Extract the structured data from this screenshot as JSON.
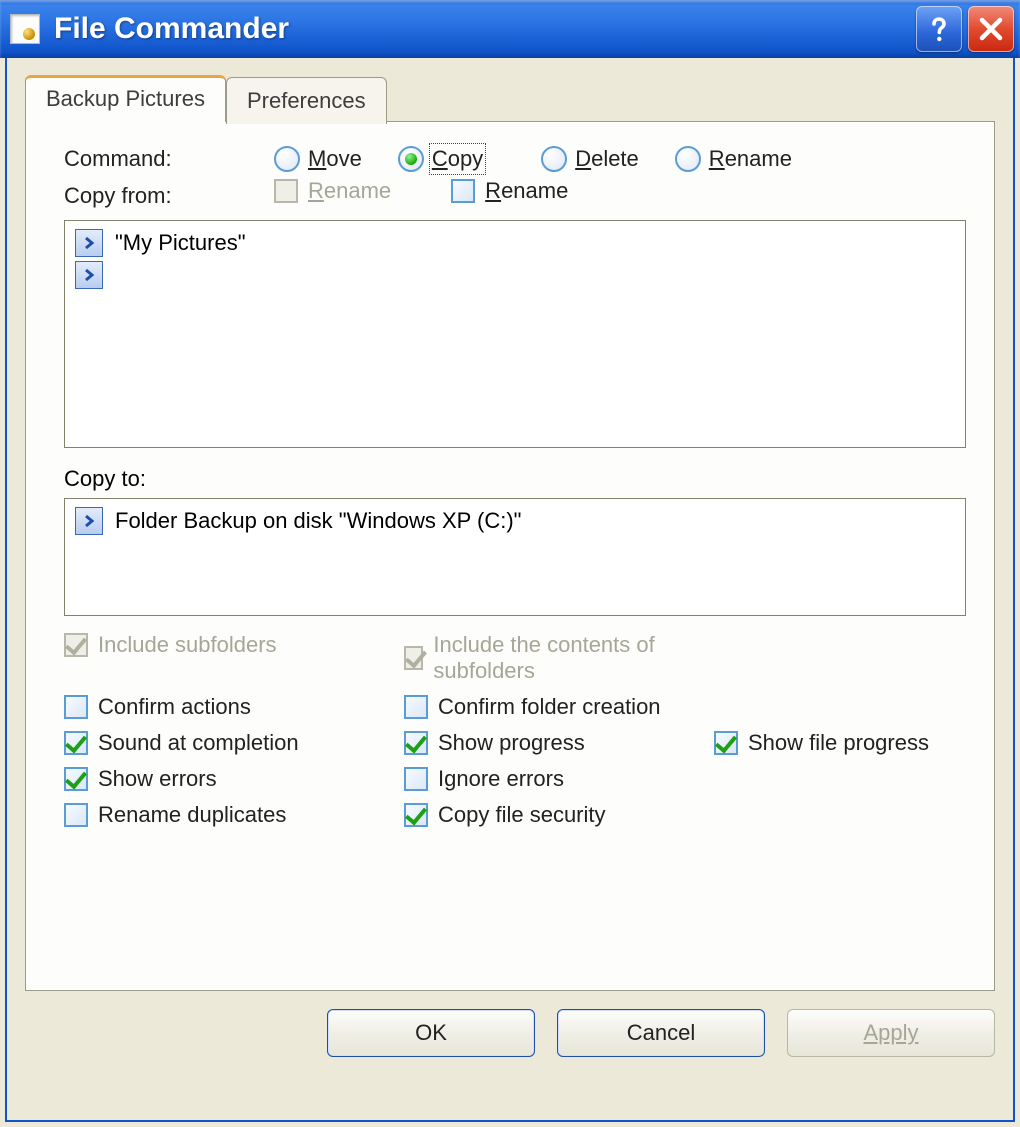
{
  "window": {
    "title": "File Commander"
  },
  "tabs": {
    "active": "Backup Pictures",
    "inactive": "Preferences"
  },
  "labels": {
    "command": "Command:",
    "copy_from": "Copy from:",
    "copy_to": "Copy to:"
  },
  "command_radios": {
    "move": {
      "text": "Move",
      "accel": "M",
      "selected": false
    },
    "copy": {
      "text": "Copy",
      "accel": "C",
      "selected": true
    },
    "delete": {
      "text": "Delete",
      "accel": "D",
      "selected": false
    },
    "rename": {
      "text": "Rename",
      "accel": "R",
      "selected": false
    }
  },
  "copy_from_flags": {
    "rename_disabled": {
      "text": "Rename",
      "accel": "R",
      "checked": false,
      "disabled": true
    },
    "rename_enabled": {
      "text": "Rename",
      "accel": "R",
      "checked": false,
      "disabled": false
    }
  },
  "paths": {
    "from": [
      "\"My Pictures\""
    ],
    "to": [
      "Folder Backup on disk \"Windows XP (C:)\""
    ]
  },
  "options": {
    "include_subfolders": {
      "text": "Include subfolders",
      "checked": true,
      "disabled": true
    },
    "include_contents_subfolders": {
      "text": "Include the contents of subfolders",
      "checked": true,
      "disabled": true
    },
    "confirm_actions": {
      "text": "Confirm actions",
      "checked": false,
      "disabled": false
    },
    "confirm_folder_creation": {
      "text": "Confirm folder creation",
      "checked": false,
      "disabled": false
    },
    "sound_at_completion": {
      "text": "Sound at completion",
      "checked": true,
      "disabled": false
    },
    "show_progress": {
      "text": "Show progress",
      "checked": true,
      "disabled": false
    },
    "show_file_progress": {
      "text": "Show file progress",
      "checked": true,
      "disabled": false
    },
    "show_errors": {
      "text": "Show errors",
      "checked": true,
      "disabled": false
    },
    "ignore_errors": {
      "text": "Ignore errors",
      "checked": false,
      "disabled": false
    },
    "rename_duplicates": {
      "text": "Rename duplicates",
      "checked": false,
      "disabled": false
    },
    "copy_file_security": {
      "text": "Copy file security",
      "checked": true,
      "disabled": false
    }
  },
  "buttons": {
    "ok": "OK",
    "cancel": "Cancel",
    "apply": "Apply"
  }
}
